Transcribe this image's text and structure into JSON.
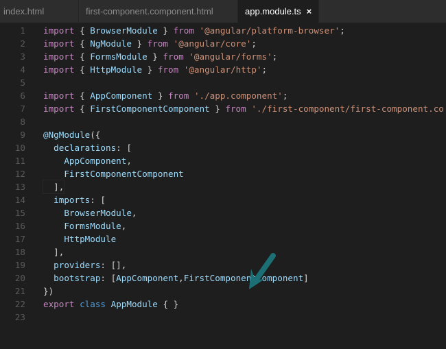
{
  "tabs": [
    {
      "label": "index.html",
      "active": false
    },
    {
      "label": "first-component.component.html",
      "active": false
    },
    {
      "label": "app.module.ts",
      "active": true,
      "close": "×"
    }
  ],
  "colors": {
    "keyword": "#c586c0",
    "identifier": "#9cdcfe",
    "string": "#ce9178",
    "arrow": "#1b6f75"
  },
  "lines": [
    [
      [
        "kw",
        "import"
      ],
      [
        "p",
        " { "
      ],
      [
        "id",
        "BrowserModule"
      ],
      [
        "p",
        " } "
      ],
      [
        "kw",
        "from"
      ],
      [
        "p",
        " "
      ],
      [
        "str",
        "'@angular/platform-browser'"
      ],
      [
        "p",
        ";"
      ]
    ],
    [
      [
        "kw",
        "import"
      ],
      [
        "p",
        " { "
      ],
      [
        "id",
        "NgModule"
      ],
      [
        "p",
        " } "
      ],
      [
        "kw",
        "from"
      ],
      [
        "p",
        " "
      ],
      [
        "str",
        "'@angular/core'"
      ],
      [
        "p",
        ";"
      ]
    ],
    [
      [
        "kw",
        "import"
      ],
      [
        "p",
        " { "
      ],
      [
        "id",
        "FormsModule"
      ],
      [
        "p",
        " } "
      ],
      [
        "kw",
        "from"
      ],
      [
        "p",
        " "
      ],
      [
        "str",
        "'@angular/forms'"
      ],
      [
        "p",
        ";"
      ]
    ],
    [
      [
        "kw",
        "import"
      ],
      [
        "p",
        " { "
      ],
      [
        "id",
        "HttpModule"
      ],
      [
        "p",
        " } "
      ],
      [
        "kw",
        "from"
      ],
      [
        "p",
        " "
      ],
      [
        "str",
        "'@angular/http'"
      ],
      [
        "p",
        ";"
      ]
    ],
    [],
    [
      [
        "kw",
        "import"
      ],
      [
        "p",
        " { "
      ],
      [
        "id",
        "AppComponent"
      ],
      [
        "p",
        " } "
      ],
      [
        "kw",
        "from"
      ],
      [
        "p",
        " "
      ],
      [
        "str",
        "'./app.component'"
      ],
      [
        "p",
        ";"
      ]
    ],
    [
      [
        "kw",
        "import"
      ],
      [
        "p",
        " { "
      ],
      [
        "id",
        "FirstComponentComponent"
      ],
      [
        "p",
        " } "
      ],
      [
        "kw",
        "from"
      ],
      [
        "p",
        " "
      ],
      [
        "str",
        "'./first-component/first-component.co"
      ]
    ],
    [],
    [
      [
        "dec",
        "@NgModule"
      ],
      [
        "p",
        "({"
      ]
    ],
    [
      [
        "p",
        "  "
      ],
      [
        "id",
        "declarations"
      ],
      [
        "p",
        ": ["
      ]
    ],
    [
      [
        "p",
        "    "
      ],
      [
        "id",
        "AppComponent"
      ],
      [
        "p",
        ","
      ]
    ],
    [
      [
        "p",
        "    "
      ],
      [
        "id",
        "FirstComponentComponent"
      ]
    ],
    [
      [
        "p",
        "  ],"
      ]
    ],
    [
      [
        "p",
        "  "
      ],
      [
        "id",
        "imports"
      ],
      [
        "p",
        ": ["
      ]
    ],
    [
      [
        "p",
        "    "
      ],
      [
        "id",
        "BrowserModule"
      ],
      [
        "p",
        ","
      ]
    ],
    [
      [
        "p",
        "    "
      ],
      [
        "id",
        "FormsModule"
      ],
      [
        "p",
        ","
      ]
    ],
    [
      [
        "p",
        "    "
      ],
      [
        "id",
        "HttpModule"
      ]
    ],
    [
      [
        "p",
        "  ],"
      ]
    ],
    [
      [
        "p",
        "  "
      ],
      [
        "id",
        "providers"
      ],
      [
        "p",
        ": [],"
      ]
    ],
    [
      [
        "p",
        "  "
      ],
      [
        "id",
        "bootstrap"
      ],
      [
        "p",
        ": ["
      ],
      [
        "id",
        "AppComponent"
      ],
      [
        "p",
        ","
      ],
      [
        "id",
        "FirstComponentComponent"
      ],
      [
        "p",
        "]"
      ]
    ],
    [
      [
        "p",
        "})"
      ]
    ],
    [
      [
        "kw",
        "export"
      ],
      [
        "p",
        " "
      ],
      [
        "kw2",
        "class"
      ],
      [
        "p",
        " "
      ],
      [
        "id",
        "AppModule"
      ],
      [
        "p",
        " { }"
      ]
    ],
    []
  ]
}
